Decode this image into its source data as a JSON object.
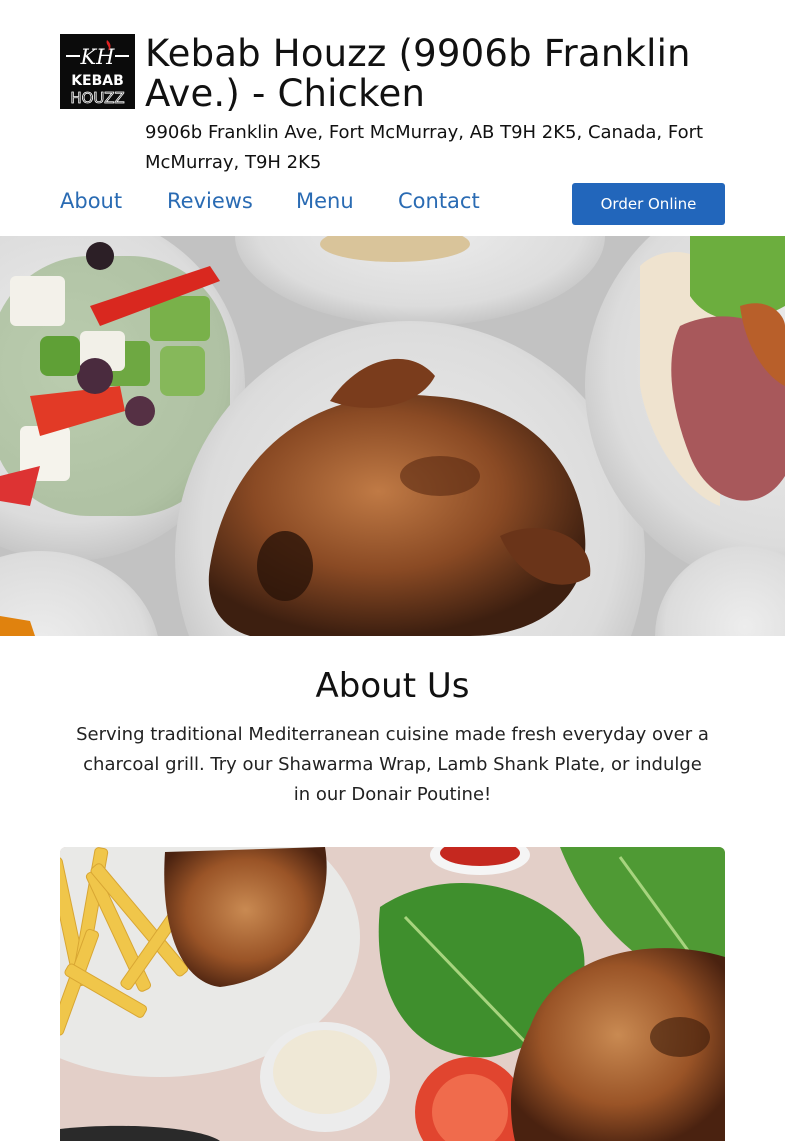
{
  "business": {
    "logo_top": "KH",
    "logo_line1": "KEBAB",
    "logo_line2": "HOUZZ",
    "name": "Kebab Houzz (9906b Franklin Ave.) - Chicken",
    "address": "9906b Franklin Ave, Fort McMurray, AB T9H 2K5, Canada, Fort McMurray, T9H 2K5"
  },
  "nav": {
    "items": [
      {
        "label": "About"
      },
      {
        "label": "Reviews"
      },
      {
        "label": "Menu"
      },
      {
        "label": "Contact"
      }
    ],
    "order_label": "Order Online"
  },
  "about": {
    "heading": "About Us",
    "body": "Serving traditional Mediterranean cuisine made fresh everyday over a charcoal grill. Try our Shawarma Wrap, Lamb Shank Plate, or indulge in our Donair Poutine!"
  },
  "colors": {
    "link": "#2a6bb3",
    "button": "#2266bb"
  }
}
